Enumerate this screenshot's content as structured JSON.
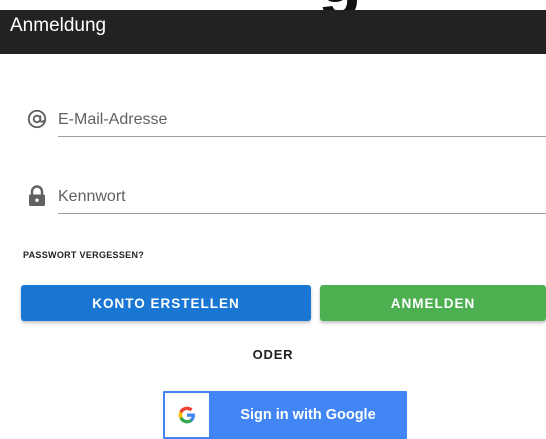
{
  "app_bar": {
    "title": "Anmeldung"
  },
  "form": {
    "email": {
      "icon": "at-sign-icon",
      "placeholder": "E-Mail-Adresse",
      "value": ""
    },
    "password": {
      "icon": "lock-icon",
      "placeholder": "Kennwort",
      "value": ""
    },
    "forgot_password_label": "PASSWORT VERGESSEN?"
  },
  "actions": {
    "create_account_label": "KONTO ERSTELLEN",
    "login_label": "ANMELDEN",
    "separator_label": "ODER",
    "google_label": "Sign in with Google",
    "google_icon": "google-g-icon"
  },
  "colors": {
    "app_bar": "#222222",
    "create_account": "#1976d2",
    "login": "#4caf50",
    "google": "#4285f4"
  }
}
